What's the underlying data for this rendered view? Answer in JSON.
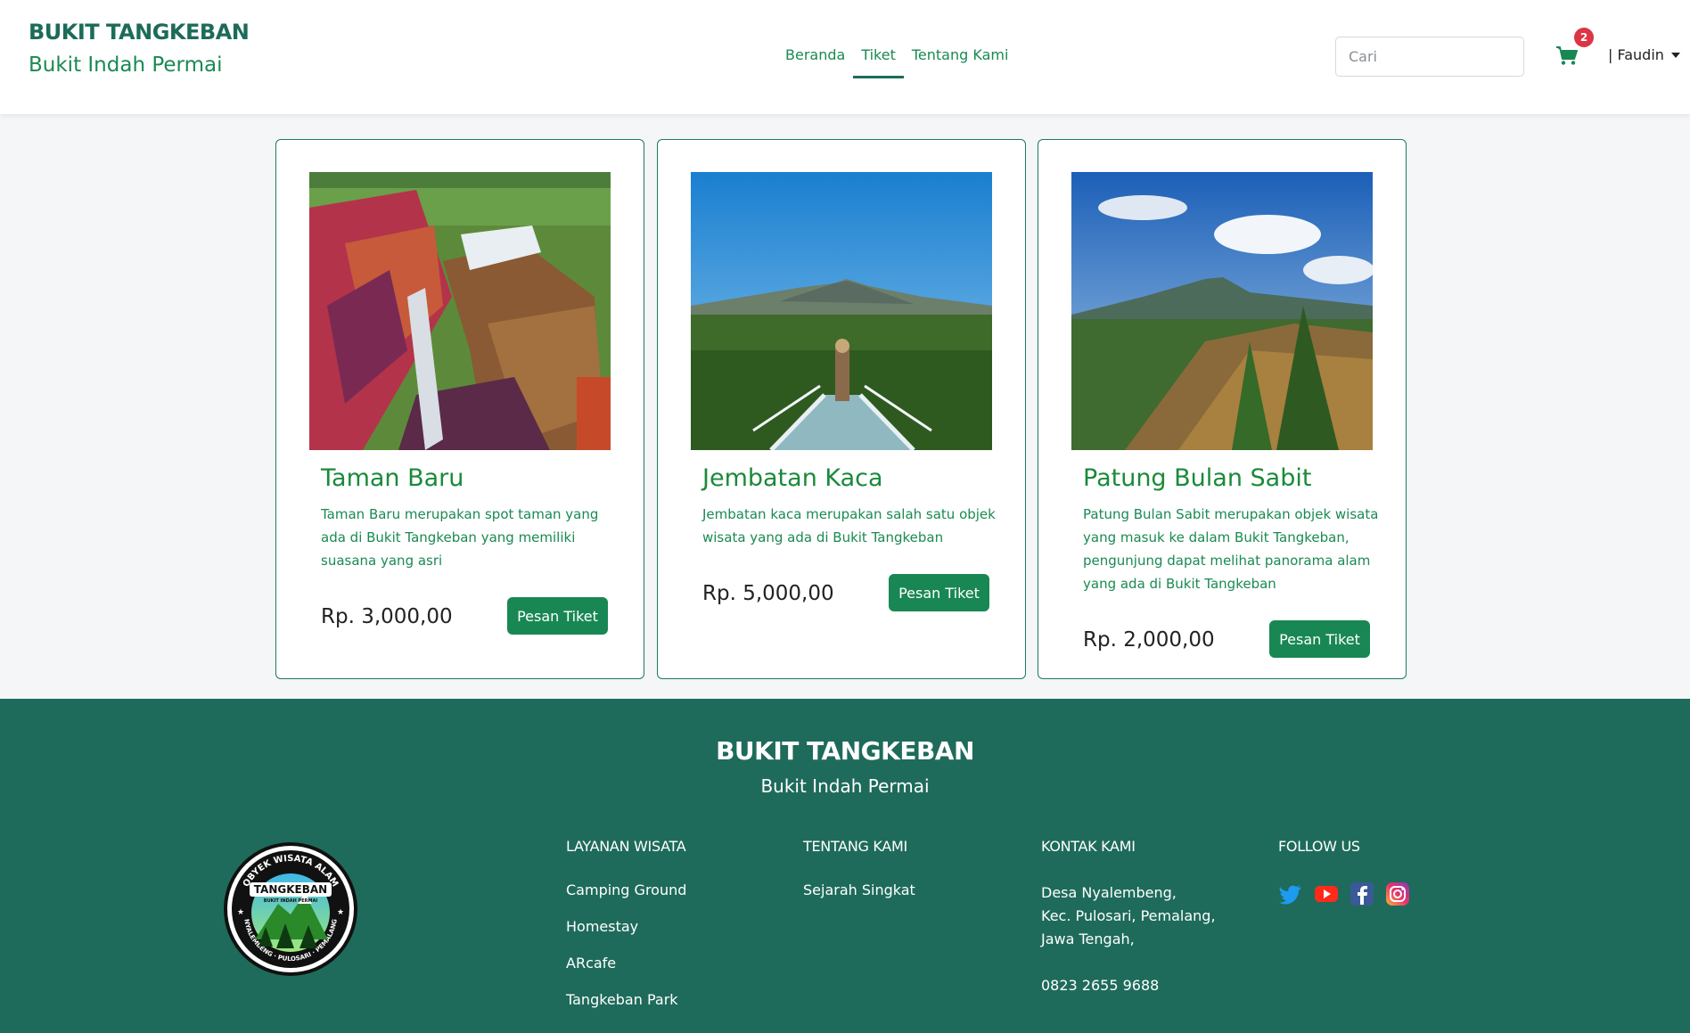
{
  "header": {
    "brand_title": "BUKIT TANGKEBAN",
    "brand_subtitle": "Bukit Indah Permai",
    "nav": [
      {
        "label": "Beranda",
        "active": false
      },
      {
        "label": "Tiket",
        "active": true
      },
      {
        "label": "Tentang Kami",
        "active": false
      }
    ],
    "search_placeholder": "Cari",
    "cart_icon": "shopping-cart-icon",
    "cart_count": "2",
    "user_label": "| Faudin"
  },
  "cards": [
    {
      "title": "Taman Baru",
      "description": "Taman Baru merupakan spot taman yang ada di Bukit Tangkeban yang memiliki suasana yang asri",
      "price": "Rp. 3,000,00",
      "button": "Pesan Tiket"
    },
    {
      "title": "Jembatan Kaca",
      "description": "Jembatan kaca merupakan salah satu objek wisata yang ada di Bukit Tangkeban",
      "price": "Rp. 5,000,00",
      "button": "Pesan Tiket"
    },
    {
      "title": "Patung Bulan Sabit",
      "description": "Patung Bulan Sabit merupakan objek wisata yang masuk ke dalam Bukit Tangkeban, pengunjung dapat melihat panorama alam yang ada di Bukit Tangkeban",
      "price": "Rp. 2,000,00",
      "button": "Pesan Tiket"
    }
  ],
  "footer": {
    "title": "BUKIT TANGKEBAN",
    "subtitle": "Bukit Indah Permai",
    "logo_text": {
      "top": "OBYEK WISATA ALAM",
      "name": "TANGKEBAN",
      "tag": "BUKIT INDAH PERMAI",
      "bottom": "NYALEMBENG · PULOSARI · PEMALANG"
    },
    "layanan": {
      "heading": "LAYANAN WISATA",
      "items": [
        "Camping Ground",
        "Homestay",
        "ARcafe",
        "Tangkeban Park"
      ]
    },
    "tentang": {
      "heading": "TENTANG KAMI",
      "items": [
        "Sejarah Singkat"
      ]
    },
    "kontak": {
      "heading": "KONTAK KAMI",
      "address_lines": [
        "Desa Nyalembeng,",
        "Kec. Pulosari, Pemalang,",
        "Jawa Tengah,"
      ],
      "phone": "0823 2655 9688"
    },
    "follow": {
      "heading": "FOLLOW US",
      "icons": [
        "twitter-icon",
        "youtube-icon",
        "facebook-icon",
        "instagram-icon"
      ]
    }
  },
  "colors": {
    "primary": "#198754",
    "footer_bg": "#1e6b5b",
    "brand": "#1d6b5a",
    "badge": "#dc3545"
  }
}
